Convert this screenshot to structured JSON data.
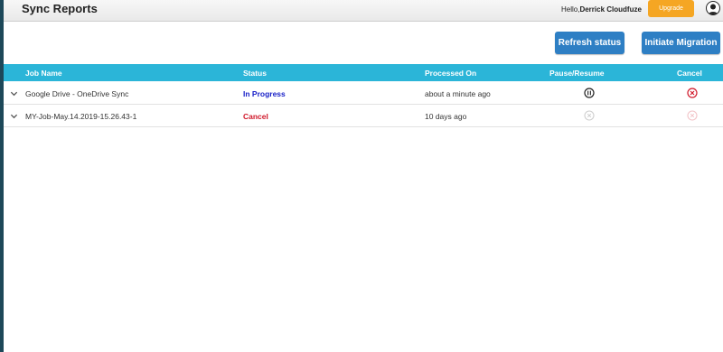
{
  "header": {
    "title": "Sync Reports",
    "greeting_prefix": "Hello,",
    "user_name": "Derrick Cloudfuze",
    "upgrade_label": "Upgrade",
    "avatar_icon": "user-avatar-icon"
  },
  "toolbar": {
    "refresh_label": "Refresh status",
    "initiate_label": "Initiate Migration"
  },
  "table": {
    "columns": [
      "Job Name",
      "Status",
      "Processed On",
      "Pause/Resume",
      "Cancel"
    ],
    "rows": [
      {
        "job_name": "Google Drive - OneDrive Sync",
        "status": "In Progress",
        "processed_on": "about a minute ago",
        "pause_icon": "pause-icon",
        "cancel_icon": "cancel-icon"
      },
      {
        "job_name": "MY-Job-May.14.2019-15.26.43-1",
        "status": "Cancel",
        "processed_on": "10 days ago",
        "pause_icon": "pause-icon",
        "cancel_icon": "cancel-icon"
      }
    ]
  },
  "colors": {
    "header_bar": "#2bb5d8",
    "button_blue": "#2e7fc4",
    "upgrade_orange": "#f5a623",
    "status_in_progress": "#1a22c8",
    "status_cancel": "#d0182a"
  }
}
